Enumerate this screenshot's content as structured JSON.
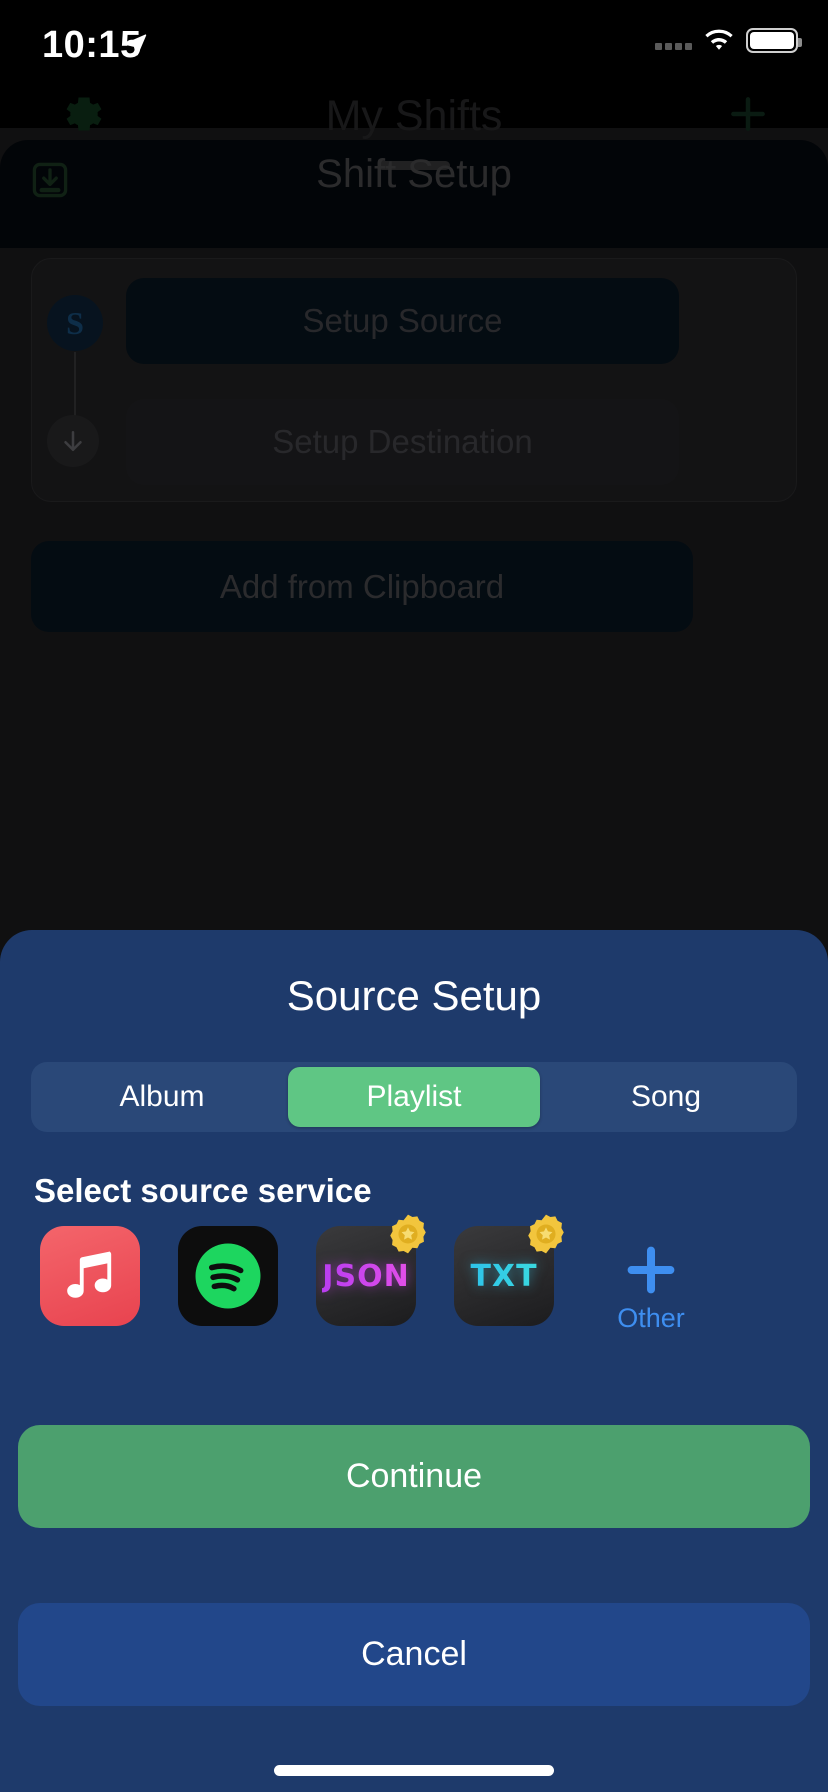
{
  "status_bar": {
    "time": "10:15",
    "location_icon": "location-arrow-icon",
    "cellular_icon": "cellular-dots-icon",
    "wifi_icon": "wifi-icon",
    "battery_icon": "battery-full-icon"
  },
  "background_app": {
    "nav_title": "My Shifts",
    "gear_icon": "gear-icon",
    "add_icon": "plus-icon",
    "sheet_title": "Shift Setup",
    "import_icon": "import-download-icon",
    "source_badge": "shift-source-icon",
    "arrow_icon": "arrow-down-icon",
    "setup_source_label": "Setup Source",
    "setup_destination_label": "Setup Destination",
    "add_from_clipboard_label": "Add from Clipboard"
  },
  "modal": {
    "title": "Source Setup",
    "segmented": {
      "options": [
        "Album",
        "Playlist",
        "Song"
      ],
      "selected": "Playlist",
      "selected_index": 1
    },
    "section_label": "Select source service",
    "services": [
      {
        "id": "apple-music",
        "name": "Apple Music",
        "icon": "apple-music-icon",
        "premium": false
      },
      {
        "id": "spotify",
        "name": "Spotify",
        "icon": "spotify-icon",
        "premium": false
      },
      {
        "id": "json",
        "name": "JSON",
        "label": "JSON",
        "icon": "json-file-icon",
        "premium": true,
        "badge_icon": "premium-badge-icon"
      },
      {
        "id": "txt",
        "name": "TXT",
        "label": "TXT",
        "icon": "txt-file-icon",
        "premium": true,
        "badge_icon": "premium-badge-icon"
      }
    ],
    "other": {
      "label": "Other",
      "icon": "plus-icon"
    },
    "continue_label": "Continue",
    "cancel_label": "Cancel"
  },
  "colors": {
    "modal_background": "#1E3A6B",
    "segment_track": "#2A4878",
    "segment_selected": "#5FC684",
    "continue_button": "#4CA06E",
    "cancel_button": "#22478A",
    "other_accent": "#3E8EF0",
    "premium_badge": "#F2C53D",
    "json_text": "#CC49F0",
    "txt_text": "#2FC6E8",
    "apple_music": "#E8434F",
    "spotify": "#1DD65F",
    "app_background": "#1C1C1E"
  },
  "home_indicator": "home-indicator"
}
